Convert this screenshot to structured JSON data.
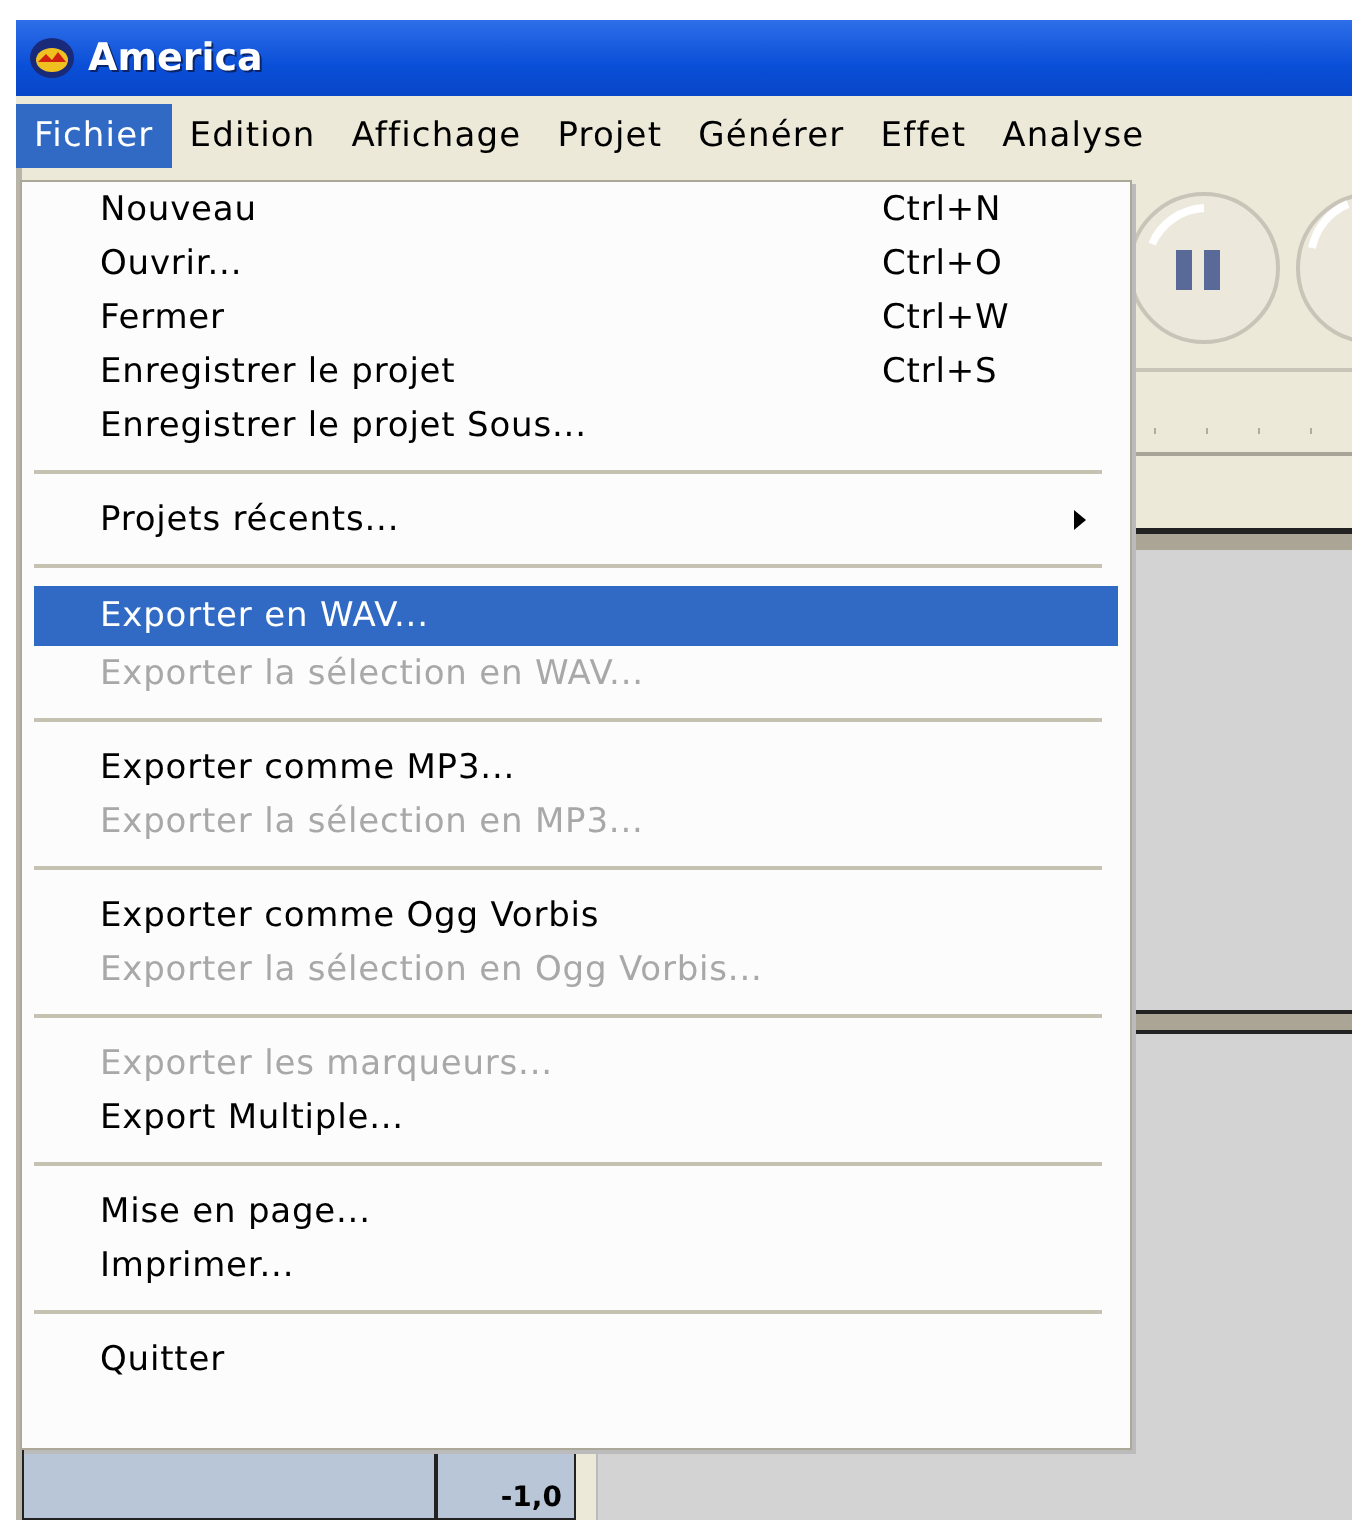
{
  "window": {
    "title": "America"
  },
  "menubar": [
    {
      "label": "Fichier",
      "selected": true
    },
    {
      "label": "Edition",
      "selected": false
    },
    {
      "label": "Affichage",
      "selected": false
    },
    {
      "label": "Projet",
      "selected": false
    },
    {
      "label": "Générer",
      "selected": false
    },
    {
      "label": "Effet",
      "selected": false
    },
    {
      "label": "Analyse",
      "selected": false
    }
  ],
  "menu": [
    {
      "kind": "item",
      "label": "Nouveau",
      "shortcut": "Ctrl+N",
      "disabled": false,
      "selected": false
    },
    {
      "kind": "item",
      "label": "Ouvrir...",
      "shortcut": "Ctrl+O",
      "disabled": false,
      "selected": false
    },
    {
      "kind": "item",
      "label": "Fermer",
      "shortcut": "Ctrl+W",
      "disabled": false,
      "selected": false
    },
    {
      "kind": "item",
      "label": "Enregistrer le projet",
      "shortcut": "Ctrl+S",
      "disabled": false,
      "selected": false
    },
    {
      "kind": "item",
      "label": "Enregistrer le projet Sous...",
      "disabled": false,
      "selected": false
    },
    {
      "kind": "separator"
    },
    {
      "kind": "submenu",
      "label": "Projets récents...",
      "disabled": false,
      "selected": false
    },
    {
      "kind": "separator"
    },
    {
      "kind": "item",
      "label": "Exporter en WAV...",
      "disabled": false,
      "selected": true
    },
    {
      "kind": "item",
      "label": "Exporter la sélection en WAV...",
      "disabled": true,
      "selected": false
    },
    {
      "kind": "separator"
    },
    {
      "kind": "item",
      "label": "Exporter comme MP3...",
      "disabled": false,
      "selected": false
    },
    {
      "kind": "item",
      "label": "Exporter la sélection en MP3...",
      "disabled": true,
      "selected": false
    },
    {
      "kind": "separator"
    },
    {
      "kind": "item",
      "label": "Exporter comme Ogg Vorbis",
      "disabled": false,
      "selected": false
    },
    {
      "kind": "item",
      "label": "Exporter la sélection en Ogg Vorbis...",
      "disabled": true,
      "selected": false
    },
    {
      "kind": "separator"
    },
    {
      "kind": "item",
      "label": "Exporter les marqueurs...",
      "disabled": true,
      "selected": false
    },
    {
      "kind": "item",
      "label": "Export Multiple...",
      "disabled": false,
      "selected": false
    },
    {
      "kind": "separator"
    },
    {
      "kind": "item",
      "label": "Mise en page...",
      "disabled": false,
      "selected": false
    },
    {
      "kind": "item",
      "label": "Imprimer...",
      "disabled": false,
      "selected": false
    },
    {
      "kind": "separator"
    },
    {
      "kind": "item",
      "label": "Quitter",
      "disabled": false,
      "selected": false
    }
  ],
  "track_panel": {
    "value": "-1,0"
  }
}
